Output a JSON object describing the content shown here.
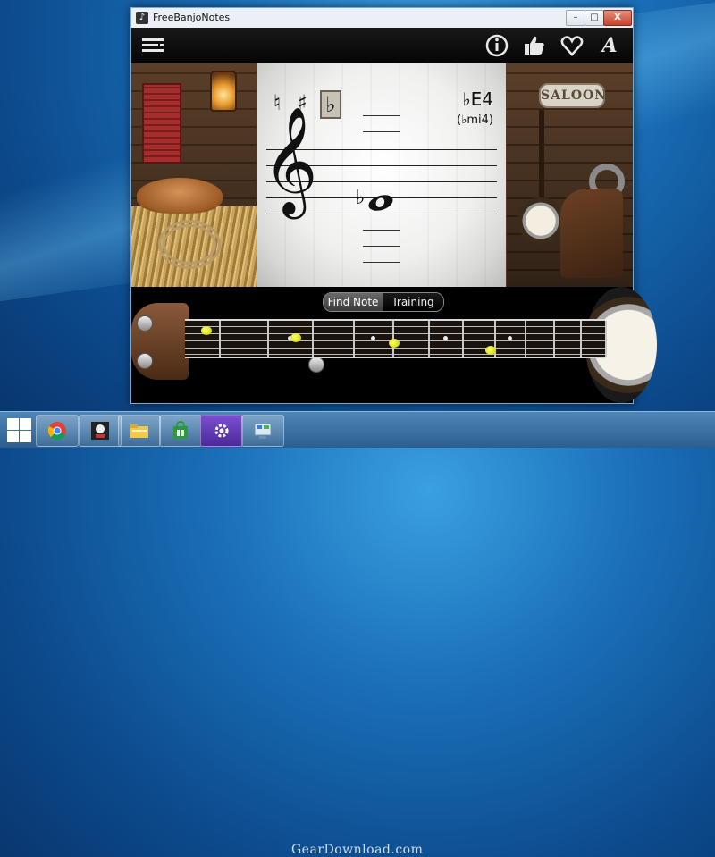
{
  "window": {
    "title": "FreeBanjoNotes",
    "controls": {
      "minimize": "–",
      "maximize": "□",
      "close": "X"
    }
  },
  "toolbar": {
    "menu_icon": "menu-icon",
    "info_icon": "info-icon",
    "like_icon": "thumbs-up-icon",
    "favorite_icon": "heart-icon",
    "font_icon": "font-icon"
  },
  "scene": {
    "saloon_sign": "SALOON"
  },
  "notation": {
    "accidentals": [
      {
        "symbol": "♮",
        "selected": false
      },
      {
        "symbol": "♯",
        "selected": false
      },
      {
        "symbol": "♭",
        "selected": true
      }
    ],
    "note_name": "♭E4",
    "note_alt": "(♭mi4)",
    "clef": "treble",
    "note_accidental": "♭"
  },
  "mode_tabs": [
    {
      "label": "Find Note",
      "active": true
    },
    {
      "label": "Training",
      "active": false
    }
  ],
  "fretboard": {
    "strings": 5,
    "frets_shown": 12,
    "highlighted_dot_color": "#e8f000"
  },
  "taskbar": {
    "apps": [
      "windows-start-icon",
      "chrome-icon",
      "freebanjonotes-icon",
      "file-explorer-icon",
      "store-icon",
      "settings-icon",
      "control-panel-icon"
    ],
    "watermark": "GearDownload.com"
  }
}
